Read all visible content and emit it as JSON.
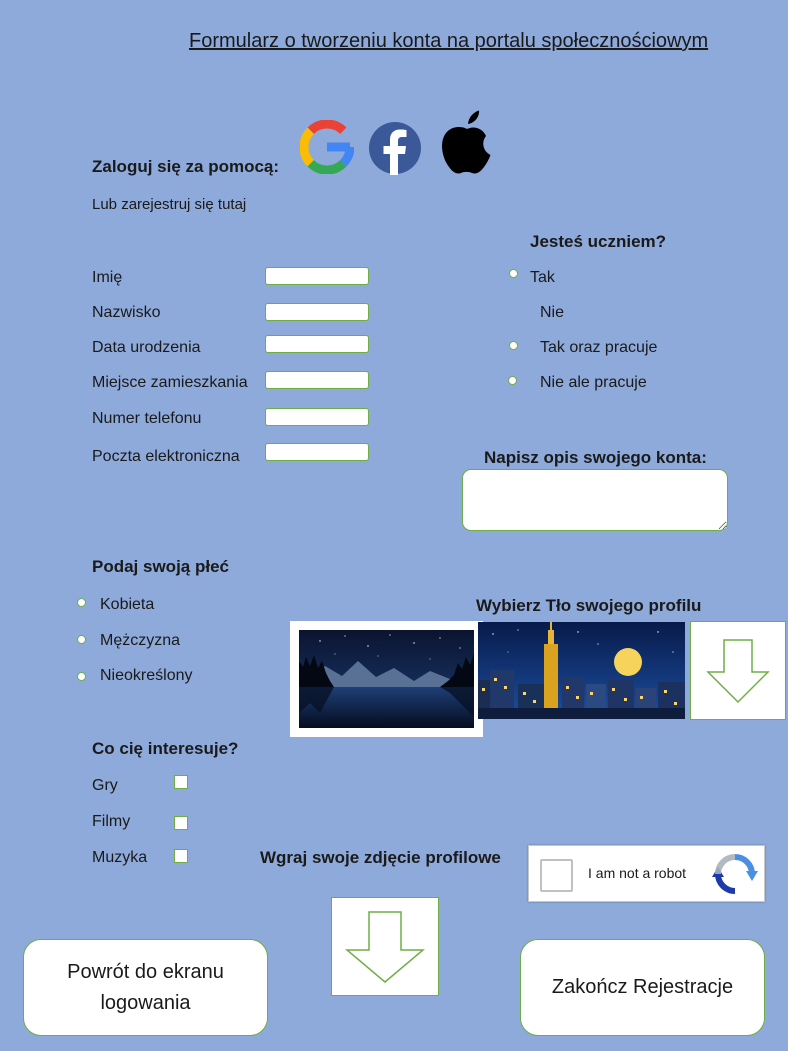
{
  "header": {
    "title": "Formularz o tworzeniu konta na portalu społecznościowym"
  },
  "login": {
    "label": "Zaloguj się za pomocą:",
    "providers": [
      "google-icon",
      "facebook-icon",
      "apple-icon"
    ],
    "register_text": "Lub zarejestruj się tutaj"
  },
  "fields": [
    {
      "label": "Imię",
      "value": ""
    },
    {
      "label": "Nazwisko",
      "value": ""
    },
    {
      "label": "Data urodzenia",
      "value": ""
    },
    {
      "label": "Miejsce zamieszkania",
      "value": ""
    },
    {
      "label": "Numer telefonu",
      "value": ""
    },
    {
      "label": "Poczta elektroniczna",
      "value": ""
    }
  ],
  "student": {
    "question": "Jesteś uczniem?",
    "options": [
      "Tak",
      "Nie",
      "Tak oraz pracuje",
      "Nie ale pracuje"
    ]
  },
  "description": {
    "label": "Napisz opis swojego konta:"
  },
  "gender": {
    "question": "Podaj swoją płeć",
    "options": [
      "Kobieta",
      "Mężczyzna",
      "Nieokreślony"
    ]
  },
  "background": {
    "label": "Wybierz Tło swojego profilu"
  },
  "interests": {
    "question": "Co cię interesuje?",
    "options": [
      "Gry",
      "Filmy",
      "Muzyka"
    ]
  },
  "upload": {
    "label": "Wgraj swoje zdjęcie profilowe"
  },
  "captcha": {
    "text": "I am not a robot"
  },
  "buttons": {
    "back": "Powrót do ekranu logowania",
    "finish": "Zakończ Rejestracje"
  },
  "colors": {
    "background": "#8eaadb",
    "accent": "#70ad47",
    "text": "#1a1a1a"
  }
}
